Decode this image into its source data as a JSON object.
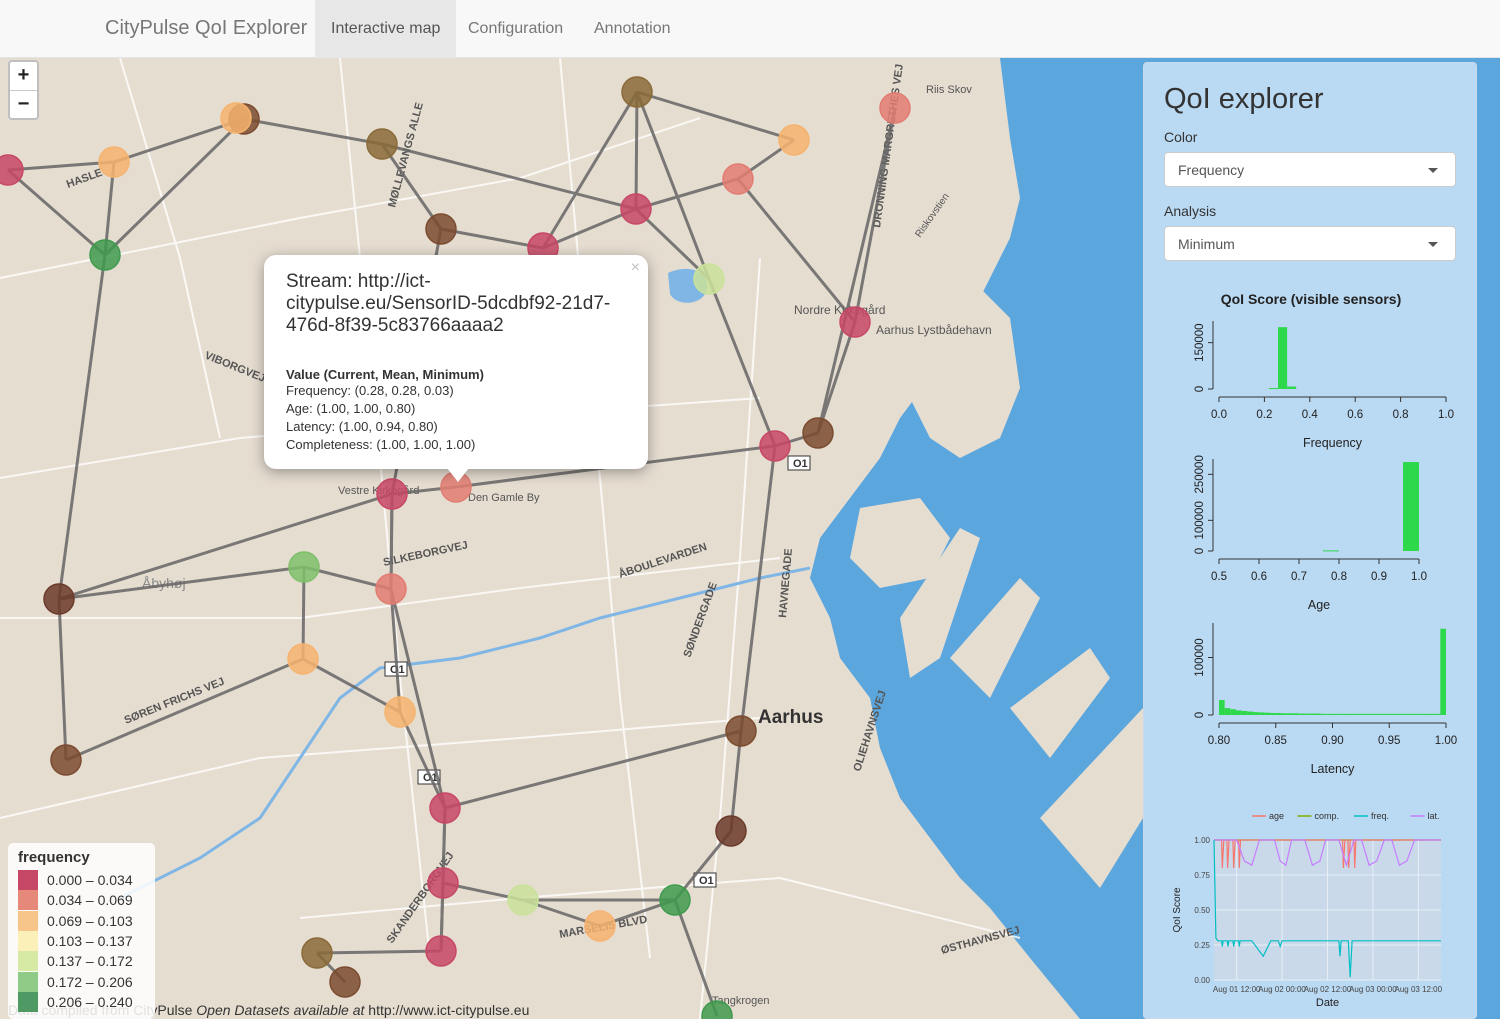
{
  "app": {
    "brand": "CityPulse QoI Explorer",
    "tabs": [
      {
        "label": "Interactive map",
        "active": true
      },
      {
        "label": "Configuration",
        "active": false
      },
      {
        "label": "Annotation",
        "active": false
      }
    ]
  },
  "map": {
    "zoom_in": "+",
    "zoom_out": "−",
    "place_labels": [
      "Riis Skov",
      "HASLE",
      "MØLLEVANGS ALLE",
      "VIBORGVEJ",
      "Nordre Kirkegård",
      "Aarhus Lystbådehavn",
      "Vestre Kirkegård",
      "Den Gamle By",
      "Åbyhøj",
      "SILKEBORGVEJ",
      "ÅBOULEVARDEN",
      "SØNDERGADE",
      "HAVNEGADE",
      "SØREN FRICHS VEJ",
      "Aarhus",
      "OLIEHAVNSVEJ",
      "SKANDERBORGVEJ",
      "MARSELIS BLVD",
      "ØSTHAVNSVEJ",
      "Tangkrogen",
      "DRONNING MARGRETHES VEJ",
      "Riskovstien",
      "O1"
    ],
    "node_colors": {
      "c1": "#c74766",
      "c2": "#e27c72",
      "c3": "#f6b36f",
      "c4": "#f7ecb0",
      "c5": "#c9e29a",
      "c6": "#7fbf6c",
      "c7": "#3f9a4e",
      "dark1": "#7a4b2f",
      "dark2": "#8a6a38",
      "dark3": "#6b3a2a"
    }
  },
  "popup": {
    "close": "×",
    "stream": "Stream: http://ict-citypulse.eu/SensorID-5dcdbf92-21d7-476d-8f39-5c83766aaaa2",
    "values_header": "Value (Current, Mean, Minimum)",
    "lines": [
      "Frequency: (0.28, 0.28, 0.03)",
      "Age: (1.00, 1.00, 0.80)",
      "Latency: (1.00, 0.94, 0.80)",
      "Completeness: (1.00, 1.00, 1.00)"
    ]
  },
  "legend": {
    "title": "frequency",
    "items": [
      {
        "label": "0.000 – 0.034",
        "color": "#c74766"
      },
      {
        "label": "0.034 – 0.069",
        "color": "#e6887a"
      },
      {
        "label": "0.069 – 0.103",
        "color": "#f7c58a"
      },
      {
        "label": "0.103 – 0.137",
        "color": "#faf0b8"
      },
      {
        "label": "0.137 – 0.172",
        "color": "#d6e9a5"
      },
      {
        "label": "0.172 – 0.206",
        "color": "#8fcb86"
      },
      {
        "label": "0.206 – 0.240",
        "color": "#4f9a64"
      }
    ]
  },
  "attribution": {
    "prefix": "Data compiled from CityPulse ",
    "italic": "Open Datasets available at",
    "suffix": " http://www.ict-citypulse.eu"
  },
  "panel": {
    "title": "QoI explorer",
    "color_label": "Color",
    "color_value": "Frequency",
    "analysis_label": "Analysis",
    "analysis_value": "Minimum",
    "hist_title": "QoI Score (visible sensors)"
  },
  "chart_data": [
    {
      "type": "bar",
      "xlabel": "Frequency",
      "xlim": [
        0.0,
        1.0
      ],
      "xticks": [
        "0.0",
        "0.2",
        "0.4",
        "0.6",
        "0.8",
        "1.0"
      ],
      "yticks": [
        "0",
        "150000"
      ],
      "ylim": [
        0,
        220000
      ],
      "bins": [
        {
          "x0": 0.22,
          "x1": 0.26,
          "y": 3000
        },
        {
          "x0": 0.26,
          "x1": 0.3,
          "y": 200000
        },
        {
          "x0": 0.3,
          "x1": 0.34,
          "y": 8000
        }
      ],
      "color": "#2ed84b"
    },
    {
      "type": "bar",
      "xlabel": "Age",
      "xlim": [
        0.5,
        1.0
      ],
      "xticks": [
        "0.5",
        "0.6",
        "0.7",
        "0.8",
        "0.9",
        "1.0"
      ],
      "yticks": [
        "0",
        "100000",
        "250000"
      ],
      "ylim": [
        0,
        300000
      ],
      "bins": [
        {
          "x0": 0.76,
          "x1": 0.8,
          "y": 2000
        },
        {
          "x0": 0.96,
          "x1": 1.0,
          "y": 290000
        }
      ],
      "color": "#2ed84b"
    },
    {
      "type": "bar",
      "xlabel": "Latency",
      "xlim": [
        0.8,
        1.0
      ],
      "xticks": [
        "0.80",
        "0.85",
        "0.90",
        "0.95",
        "1.00"
      ],
      "yticks": [
        "0",
        "100000"
      ],
      "ylim": [
        0,
        160000
      ],
      "bins": [
        {
          "x0": 0.8,
          "x1": 0.805,
          "y": 26000
        },
        {
          "x0": 0.805,
          "x1": 0.81,
          "y": 12000
        },
        {
          "x0": 0.81,
          "x1": 0.815,
          "y": 10000
        },
        {
          "x0": 0.815,
          "x1": 0.82,
          "y": 8000
        },
        {
          "x0": 0.82,
          "x1": 0.825,
          "y": 7000
        },
        {
          "x0": 0.825,
          "x1": 0.83,
          "y": 6000
        },
        {
          "x0": 0.83,
          "x1": 0.835,
          "y": 5000
        },
        {
          "x0": 0.835,
          "x1": 0.84,
          "y": 4500
        },
        {
          "x0": 0.84,
          "x1": 0.845,
          "y": 4000
        },
        {
          "x0": 0.845,
          "x1": 0.85,
          "y": 3500
        },
        {
          "x0": 0.85,
          "x1": 0.855,
          "y": 3500
        },
        {
          "x0": 0.855,
          "x1": 0.86,
          "y": 3000
        },
        {
          "x0": 0.86,
          "x1": 0.865,
          "y": 3000
        },
        {
          "x0": 0.865,
          "x1": 0.87,
          "y": 3000
        },
        {
          "x0": 0.87,
          "x1": 0.875,
          "y": 2500
        },
        {
          "x0": 0.875,
          "x1": 0.88,
          "y": 2500
        },
        {
          "x0": 0.88,
          "x1": 0.885,
          "y": 2500
        },
        {
          "x0": 0.885,
          "x1": 0.89,
          "y": 2500
        },
        {
          "x0": 0.89,
          "x1": 0.895,
          "y": 2000
        },
        {
          "x0": 0.895,
          "x1": 0.9,
          "y": 2000
        },
        {
          "x0": 0.9,
          "x1": 0.905,
          "y": 2000
        },
        {
          "x0": 0.905,
          "x1": 0.91,
          "y": 2000
        },
        {
          "x0": 0.91,
          "x1": 0.915,
          "y": 2000
        },
        {
          "x0": 0.915,
          "x1": 0.92,
          "y": 2000
        },
        {
          "x0": 0.92,
          "x1": 0.925,
          "y": 2000
        },
        {
          "x0": 0.925,
          "x1": 0.93,
          "y": 2000
        },
        {
          "x0": 0.93,
          "x1": 0.935,
          "y": 2000
        },
        {
          "x0": 0.935,
          "x1": 0.94,
          "y": 2000
        },
        {
          "x0": 0.94,
          "x1": 0.945,
          "y": 2000
        },
        {
          "x0": 0.945,
          "x1": 0.95,
          "y": 2000
        },
        {
          "x0": 0.95,
          "x1": 0.955,
          "y": 2000
        },
        {
          "x0": 0.955,
          "x1": 0.96,
          "y": 2000
        },
        {
          "x0": 0.96,
          "x1": 0.965,
          "y": 2000
        },
        {
          "x0": 0.965,
          "x1": 0.97,
          "y": 2000
        },
        {
          "x0": 0.97,
          "x1": 0.975,
          "y": 2000
        },
        {
          "x0": 0.975,
          "x1": 0.98,
          "y": 2000
        },
        {
          "x0": 0.98,
          "x1": 0.985,
          "y": 2000
        },
        {
          "x0": 0.985,
          "x1": 0.99,
          "y": 2000
        },
        {
          "x0": 0.99,
          "x1": 0.995,
          "y": 2000
        },
        {
          "x0": 0.995,
          "x1": 1.0,
          "y": 150000
        }
      ],
      "color": "#2ed84b"
    },
    {
      "type": "line",
      "xlabel": "Date",
      "ylabel": "QoI Score",
      "ylim": [
        0.0,
        1.0
      ],
      "yticks": [
        "0.00",
        "0.25",
        "0.50",
        "0.75",
        "1.00"
      ],
      "xticks": [
        "Aug 01 12:00",
        "Aug 02 00:00",
        "Aug 02 12:00",
        "Aug 03 00:00",
        "Aug 03 12:00"
      ],
      "x_range_hours": [
        0,
        60
      ],
      "legend": [
        "age",
        "comp.",
        "freq.",
        "lat."
      ],
      "series": [
        {
          "name": "comp.",
          "color": "#7cae00",
          "points": [
            [
              0,
              1.0
            ],
            [
              60,
              1.0
            ]
          ]
        },
        {
          "name": "age",
          "color": "#f8766d",
          "points": [
            [
              0,
              1.0
            ],
            [
              2,
              1.0
            ],
            [
              2.2,
              0.8
            ],
            [
              2.6,
              1.0
            ],
            [
              3.4,
              1.0
            ],
            [
              3.6,
              0.8
            ],
            [
              4,
              1.0
            ],
            [
              5,
              1.0
            ],
            [
              5.2,
              0.8
            ],
            [
              5.6,
              1.0
            ],
            [
              6.5,
              1.0
            ],
            [
              6.7,
              0.8
            ],
            [
              7,
              1.0
            ],
            [
              34,
              1.0
            ],
            [
              34.2,
              0.8
            ],
            [
              34.6,
              1.0
            ],
            [
              35.4,
              1.0
            ],
            [
              35.6,
              0.8
            ],
            [
              36,
              1.0
            ],
            [
              37,
              1.0
            ],
            [
              37.2,
              0.8
            ],
            [
              37.5,
              1.0
            ],
            [
              60,
              1.0
            ]
          ]
        },
        {
          "name": "lat.",
          "color": "#c77cff",
          "points": [
            [
              0,
              1.0
            ],
            [
              6,
              1.0
            ],
            [
              8,
              0.85
            ],
            [
              10,
              0.82
            ],
            [
              12,
              1.0
            ],
            [
              16,
              1.0
            ],
            [
              17.5,
              0.85
            ],
            [
              19,
              0.82
            ],
            [
              20.5,
              1.0
            ],
            [
              24,
              1.0
            ],
            [
              26,
              0.82
            ],
            [
              28,
              0.85
            ],
            [
              29.5,
              1.0
            ],
            [
              33,
              1.0
            ],
            [
              35,
              0.82
            ],
            [
              37,
              1.0
            ],
            [
              39,
              1.0
            ],
            [
              41,
              0.82
            ],
            [
              43,
              0.85
            ],
            [
              45,
              1.0
            ],
            [
              47,
              1.0
            ],
            [
              49,
              0.82
            ],
            [
              51,
              0.85
            ],
            [
              53,
              1.0
            ],
            [
              60,
              1.0
            ]
          ]
        },
        {
          "name": "freq.",
          "color": "#00bfc4",
          "points": [
            [
              0,
              1.0
            ],
            [
              0.5,
              0.3
            ],
            [
              1,
              0.28
            ],
            [
              2,
              0.28
            ],
            [
              2.2,
              0.24
            ],
            [
              2.4,
              0.28
            ],
            [
              3.5,
              0.28
            ],
            [
              3.7,
              0.24
            ],
            [
              3.9,
              0.28
            ],
            [
              5,
              0.28
            ],
            [
              5.2,
              0.24
            ],
            [
              5.4,
              0.28
            ],
            [
              6.5,
              0.28
            ],
            [
              6.7,
              0.24
            ],
            [
              6.9,
              0.28
            ],
            [
              10,
              0.28
            ],
            [
              13,
              0.17
            ],
            [
              15,
              0.28
            ],
            [
              17,
              0.28
            ],
            [
              17.5,
              0.24
            ],
            [
              18,
              0.28
            ],
            [
              33,
              0.28
            ],
            [
              33.3,
              0.17
            ],
            [
              33.6,
              0.28
            ],
            [
              35.5,
              0.28
            ],
            [
              36,
              0.02
            ],
            [
              36.5,
              0.28
            ],
            [
              60,
              0.28
            ]
          ]
        }
      ]
    }
  ]
}
